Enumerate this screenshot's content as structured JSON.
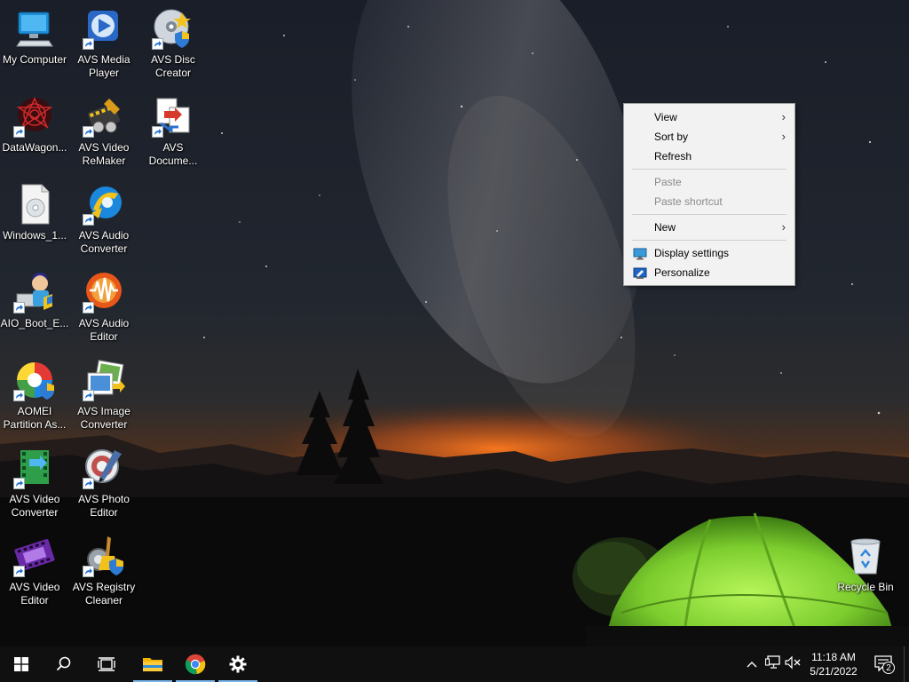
{
  "desktop": {
    "icons": [
      {
        "label": "My Computer",
        "icon": "computer-icon",
        "shortcut": false
      },
      {
        "label": "AVS Media\nPlayer",
        "icon": "media-player-icon",
        "shortcut": true
      },
      {
        "label": "AVS Disc\nCreator",
        "icon": "disc-creator-icon",
        "shortcut": true
      },
      {
        "label": "DataWagon...",
        "icon": "datawagon-icon",
        "shortcut": true
      },
      {
        "label": "AVS Video\nReMaker",
        "icon": "video-remaker-icon",
        "shortcut": true
      },
      {
        "label": "AVS\nDocume...",
        "icon": "document-converter-icon",
        "shortcut": true
      },
      {
        "label": "Windows_1...",
        "icon": "disc-image-icon",
        "shortcut": false
      },
      {
        "label": "AVS Audio\nConverter",
        "icon": "audio-converter-icon",
        "shortcut": true
      },
      {
        "label": "AIO_Boot_E...",
        "icon": "aio-boot-icon",
        "shortcut": true
      },
      {
        "label": "AVS Audio\nEditor",
        "icon": "audio-editor-icon",
        "shortcut": true
      },
      {
        "label": "AOMEI\nPartition As...",
        "icon": "aomei-partition-icon",
        "shortcut": true
      },
      {
        "label": "AVS Image\nConverter",
        "icon": "image-converter-icon",
        "shortcut": true
      },
      {
        "label": "AVS Video\nConverter",
        "icon": "video-converter-icon",
        "shortcut": true
      },
      {
        "label": "AVS Photo\nEditor",
        "icon": "photo-editor-icon",
        "shortcut": true
      },
      {
        "label": "AVS Video\nEditor",
        "icon": "video-editor-icon",
        "shortcut": true
      },
      {
        "label": "AVS Registry\nCleaner",
        "icon": "registry-cleaner-icon",
        "shortcut": true
      }
    ],
    "recycle_bin": {
      "label": "Recycle Bin",
      "icon": "recycle-bin-icon"
    }
  },
  "context_menu": {
    "items": [
      {
        "label": "View",
        "submenu": true,
        "disabled": false
      },
      {
        "label": "Sort by",
        "submenu": true,
        "disabled": false
      },
      {
        "label": "Refresh",
        "submenu": false,
        "disabled": false
      },
      {
        "label": "Paste",
        "submenu": false,
        "disabled": true
      },
      {
        "label": "Paste shortcut",
        "submenu": false,
        "disabled": true
      },
      {
        "label": "New",
        "submenu": true,
        "disabled": false
      },
      {
        "label": "Display settings",
        "submenu": false,
        "disabled": false,
        "icon": "display-icon"
      },
      {
        "label": "Personalize",
        "submenu": false,
        "disabled": false,
        "icon": "personalize-icon"
      }
    ],
    "arrow_glyph": "›"
  },
  "taskbar": {
    "buttons": [
      {
        "name": "start-button",
        "icon": "windows-logo-icon"
      },
      {
        "name": "search-button",
        "icon": "search-icon"
      },
      {
        "name": "task-view-button",
        "icon": "task-view-icon"
      },
      {
        "name": "file-explorer-button",
        "icon": "folder-icon",
        "active": true
      },
      {
        "name": "chrome-button",
        "icon": "chrome-icon",
        "active": true
      },
      {
        "name": "settings-button",
        "icon": "gear-icon",
        "active": true
      }
    ],
    "tray": {
      "chevron_icon": "chevron-up-icon",
      "network_icon": "network-icon",
      "volume_icon": "volume-muted-icon",
      "notification_count": "2"
    },
    "clock": {
      "time": "11:18 AM",
      "date": "5/21/2022"
    }
  },
  "colors": {
    "taskbar_bg": "#101010",
    "menu_bg": "#f2f2f2",
    "accent": "#7ab4e8",
    "tent": "#8fe03a"
  }
}
